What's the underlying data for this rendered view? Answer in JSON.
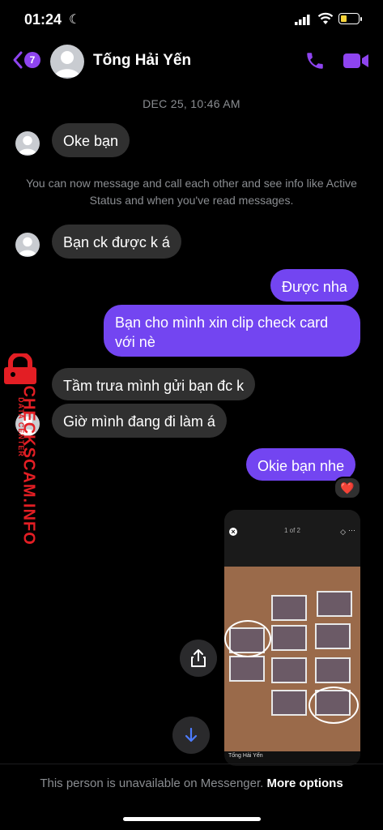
{
  "status": {
    "time": "01:24"
  },
  "header": {
    "back_count": "7",
    "name": "Tống Hải Yến"
  },
  "thread": {
    "date": "DEC 25, 10:46 AM",
    "info": "You can now message and call each other and see info like Active Status and when you've read messages.",
    "messages": [
      {
        "from": "them",
        "text": "Oke bạn"
      },
      {
        "from": "them",
        "text": "Bạn ck được k á"
      },
      {
        "from": "me",
        "text": "Được nha"
      },
      {
        "from": "me",
        "text": "Bạn cho mình xin clip check card với nè"
      },
      {
        "from": "them",
        "text": "Tầm trưa mình gửi bạn đc k"
      },
      {
        "from": "them",
        "text": "Giờ mình đang đi làm á"
      },
      {
        "from": "me",
        "text": "Okie bạn nhe"
      }
    ],
    "reaction": "❤️",
    "photo": {
      "counter": "1 of 2",
      "caption": "Tống Hải Yến"
    }
  },
  "watermark": {
    "brand": "CHECKSCAM.INFO",
    "sub": "DATA CENTER"
  },
  "footer": {
    "notice": "This person is unavailable on Messenger.",
    "action": "More options"
  },
  "colors": {
    "outgoing": "#7345f1",
    "incoming": "#303030",
    "accent": "#8e44ef"
  }
}
